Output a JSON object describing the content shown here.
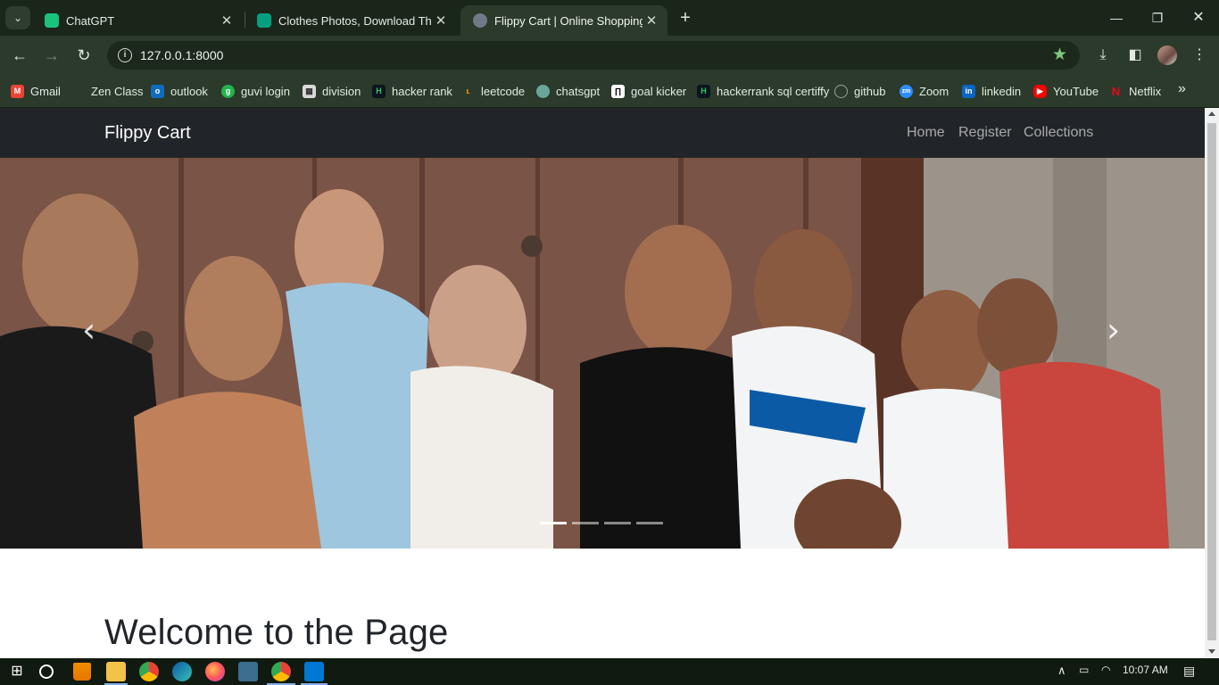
{
  "browser": {
    "tabs": [
      {
        "title": "ChatGPT",
        "active": false
      },
      {
        "title": "Clothes Photos, Download The B",
        "active": false
      },
      {
        "title": "Flippy Cart | Online Shopping",
        "active": true
      }
    ],
    "url": "127.0.0.1:8000",
    "bookmarks": [
      "Gmail",
      "Zen Class",
      "outlook",
      "guvi login",
      "division",
      "hacker rank",
      "leetcode",
      "chatsgpt",
      "goal kicker",
      "hackerrank sql certiffy",
      "github",
      "Zoom",
      "linkedin",
      "YouTube",
      "Netflix"
    ]
  },
  "site": {
    "brand": "Flippy Cart",
    "nav": [
      "Home",
      "Register",
      "Collections"
    ],
    "carousel": {
      "prev": "‹",
      "next": "›",
      "slides": 4,
      "active_index": 0
    },
    "heading": "Welcome to the Page"
  },
  "taskbar": {
    "time": "10:07 AM"
  },
  "colors": {
    "navbar": "#212529",
    "browser_frame": "#1f2b1f",
    "bookmark_star": "#7cc97a"
  }
}
